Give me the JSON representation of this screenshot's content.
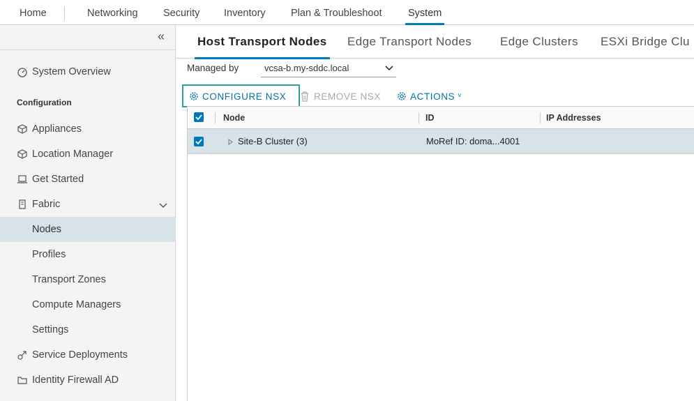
{
  "topnav": {
    "items": [
      "Home",
      "Networking",
      "Security",
      "Inventory",
      "Plan & Troubleshoot",
      "System"
    ],
    "active": "System"
  },
  "sidebar": {
    "collapse_icon": "double-chevron-left-icon",
    "system_overview": "System Overview",
    "configuration_heading": "Configuration",
    "items": [
      {
        "label": "Appliances",
        "icon": "cube-icon"
      },
      {
        "label": "Location Manager",
        "icon": "cube-icon"
      },
      {
        "label": "Get Started",
        "icon": "laptop-icon"
      },
      {
        "label": "Fabric",
        "icon": "server-icon"
      },
      {
        "label": "Nodes"
      },
      {
        "label": "Profiles"
      },
      {
        "label": "Transport Zones"
      },
      {
        "label": "Compute Managers"
      },
      {
        "label": "Settings"
      },
      {
        "label": "Service Deployments",
        "icon": "link-icon"
      },
      {
        "label": "Identity Firewall AD",
        "icon": "folder-icon"
      }
    ],
    "selected": "Nodes"
  },
  "tabs": [
    "Host Transport Nodes",
    "Edge Transport Nodes",
    "Edge Clusters",
    "ESXi Bridge Clu"
  ],
  "active_tab": "Host Transport Nodes",
  "managed_by": {
    "label": "Managed by",
    "value": "vcsa-b.my-sddc.local"
  },
  "toolbar": {
    "configure": "CONFIGURE NSX",
    "remove": "REMOVE NSX",
    "actions": "ACTIONS"
  },
  "grid": {
    "columns": [
      "Node",
      "ID",
      "IP Addresses"
    ],
    "rows": [
      {
        "node": "Site-B Cluster (3)",
        "id": "MoRef ID: doma...4001",
        "ip": "",
        "checked": true
      }
    ]
  },
  "colors": {
    "accent": "#0079b8",
    "highlight_border": "#2aa39a",
    "selected_bg": "#d8e3e9"
  }
}
